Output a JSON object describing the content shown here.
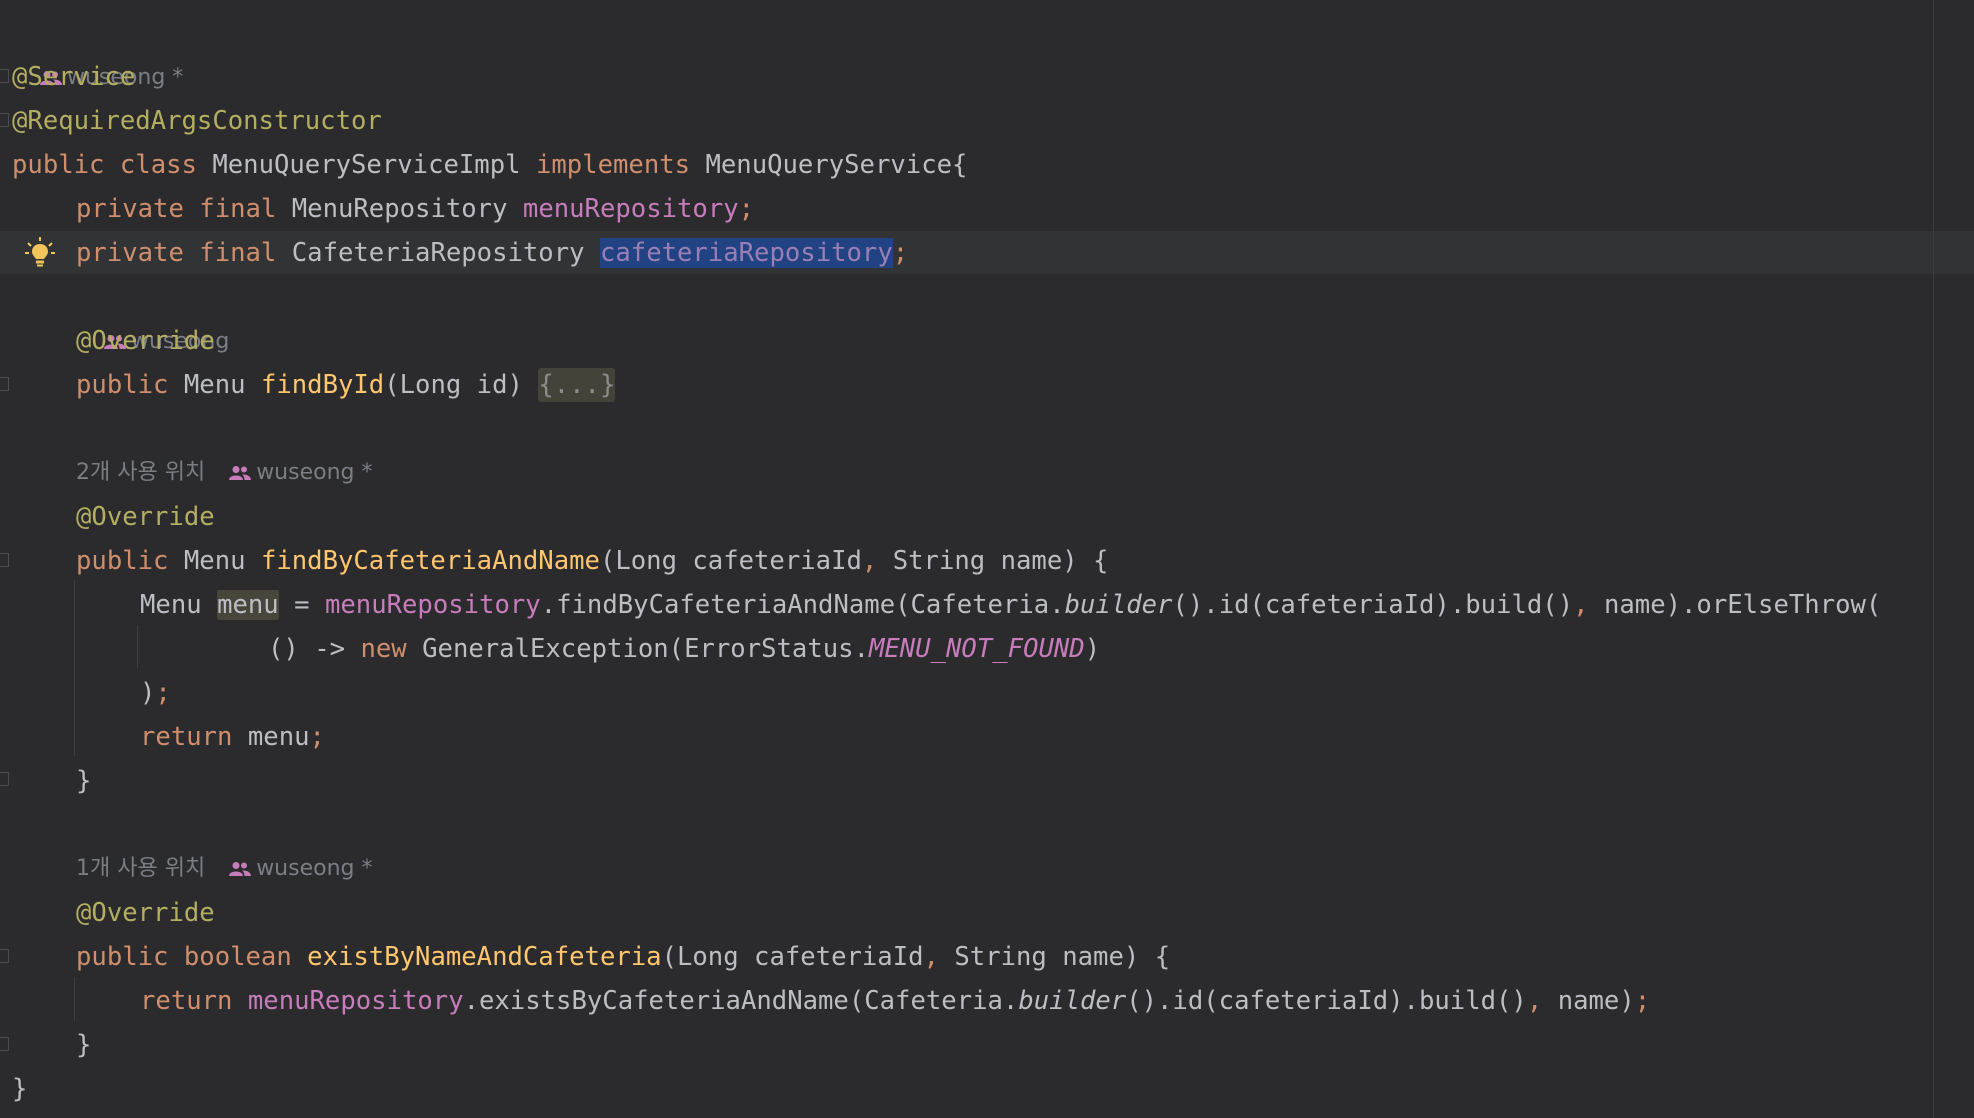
{
  "author_hints": {
    "class_author": "wuseong *",
    "findById_author": "wuseong",
    "findByCafeteriaAndName_usages": "2개 사용 위치",
    "findByCafeteriaAndName_author": "wuseong *",
    "existByNameAndCafeteria_usages": "1개 사용 위치",
    "existByNameAndCafeteria_author": "wuseong *"
  },
  "code": {
    "ann_service": "@Service",
    "ann_required_args": "@RequiredArgsConstructor",
    "class_decl": {
      "kw_public": "public",
      "kw_class": "class",
      "class_name": "MenuQueryServiceImpl",
      "kw_implements": "implements",
      "interface_name": "MenuQueryService{"
    },
    "field1": {
      "kw_private": "private",
      "kw_final": "final",
      "type": "MenuRepository",
      "name": "menuRepository",
      "semicolon": ";"
    },
    "field2": {
      "kw_private": "private",
      "kw_final": "final",
      "type": "CafeteriaRepository",
      "name": "cafeteriaRepository",
      "semicolon": ";"
    },
    "ann_override": "@Override",
    "findById": {
      "kw_public": "public",
      "ret": "Menu",
      "name": "findById",
      "params": "(Long id)",
      "folded": "{...}"
    },
    "findByCafeteriaAndName": {
      "kw_public": "public",
      "ret": "Menu",
      "name": "findByCafeteriaAndName",
      "params_a": "(Long cafeteriaId",
      "comma": ",",
      "params_b": "String name) {",
      "l1_type": "Menu",
      "l1_var": "menu",
      "l1_eq": "=",
      "l1_field": "menuRepository",
      "l1_call_a": ".findByCafeteriaAndName(Cafeteria.",
      "l1_builder": "builder",
      "l1_call_b": "().id(cafeteriaId).build()",
      "l1_comma": ",",
      "l1_call_c": "name).orElseThrow(",
      "l2_lambda": "() ->",
      "l2_new": "new",
      "l2_call": "GeneralException(ErrorStatus.",
      "l2_const": "MENU_NOT_FOUND",
      "l2_close": ")",
      "l3_close": ")",
      "l3_semi": ";",
      "l4_return": "return",
      "l4_var": "menu",
      "l4_semi": ";",
      "close": "}"
    },
    "existByNameAndCafeteria": {
      "kw_public": "public",
      "ret": "boolean",
      "name": "existByNameAndCafeteria",
      "params_a": "(Long cafeteriaId",
      "comma": ",",
      "params_b": "String name) {",
      "l1_return": "return",
      "l1_field": "menuRepository",
      "l1_call_a": ".existsByCafeteriaAndName(Cafeteria.",
      "l1_builder": "builder",
      "l1_call_b": "().id(cafeteriaId).build()",
      "l1_comma": ",",
      "l1_name": "name)",
      "l1_semi": ";",
      "close": "}"
    },
    "class_close": "}"
  }
}
